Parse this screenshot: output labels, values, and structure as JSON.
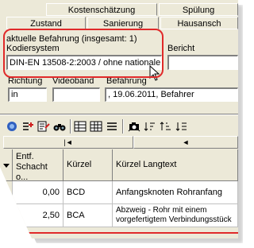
{
  "tabs": {
    "row1": [
      "Kostenschätzung",
      "Spülung"
    ],
    "row2": [
      "Zustand",
      "Sanierung",
      "Hausansch"
    ]
  },
  "befahrung": {
    "title": "aktuelle Befahrung (insgesamt: 1)",
    "kodiersystem_label": "Kodiersystem",
    "kodiersystem_value": "DIN-EN 13508-2:2003 / ohne nationale",
    "bericht_label": "Bericht",
    "bericht_value": ""
  },
  "fields": {
    "richtung_label": "Richtung",
    "richtung_value": "in",
    "videoband_label": "Videoband",
    "videoband_value": "",
    "befahrung_label": "Befahrung",
    "befahrung_value": ", 19.06.2011, Befahrer"
  },
  "nav": {
    "first": "|◄",
    "prev": "◄"
  },
  "table": {
    "headers": [
      "Entf. Schacht o...",
      "Kürzel",
      "Kürzel Langtext"
    ],
    "rows": [
      {
        "entf": "0,00",
        "kuerzel": "BCD",
        "langtext": "Anfangsknoten Rohranfang"
      },
      {
        "entf": "2,50",
        "kuerzel": "BCA",
        "langtext": "Abzweig - Rohr mit einem vorgefertigtem Verbindungsstück"
      }
    ]
  },
  "colors": {
    "highlight": "#e02a2a",
    "window": "#ece9d8"
  }
}
